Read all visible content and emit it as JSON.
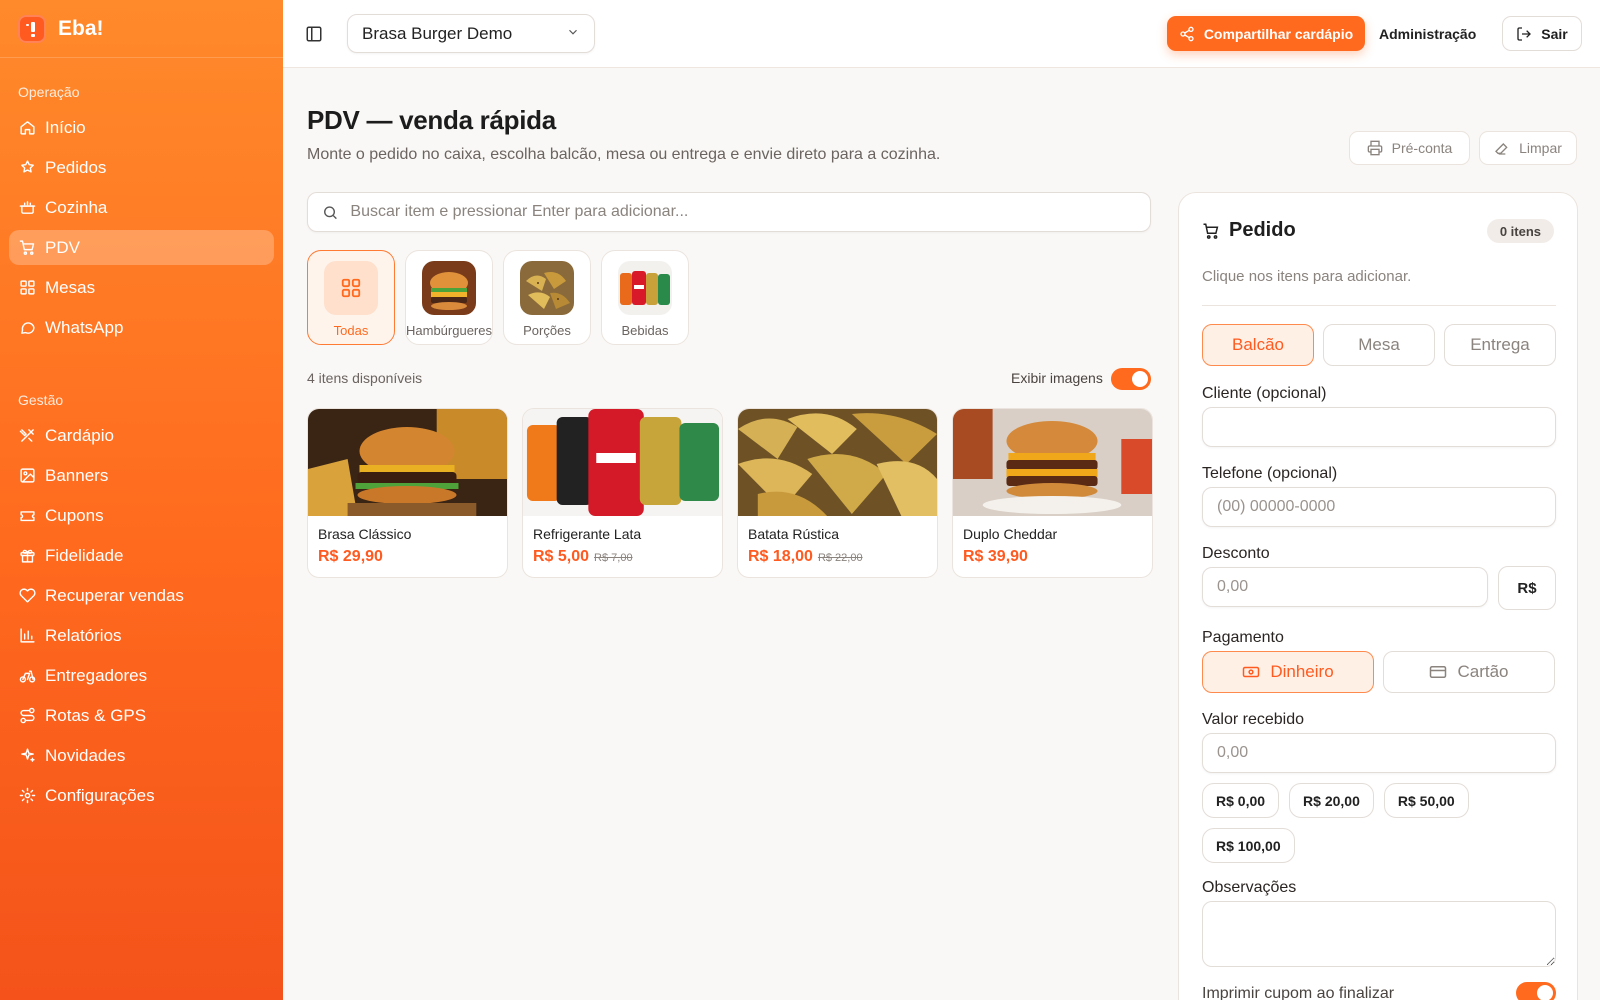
{
  "brand": {
    "name": "Eba!"
  },
  "sidebar": {
    "sections": [
      {
        "title": "Operação",
        "items": [
          {
            "label": "Início",
            "icon": "home-icon"
          },
          {
            "label": "Pedidos",
            "icon": "receipt-icon"
          },
          {
            "label": "Cozinha",
            "icon": "cooking-pot-icon"
          },
          {
            "label": "PDV",
            "icon": "cart-icon",
            "active": true
          },
          {
            "label": "Mesas",
            "icon": "grid-icon"
          },
          {
            "label": "WhatsApp",
            "icon": "chat-icon"
          }
        ]
      },
      {
        "title": "Gestão",
        "items": [
          {
            "label": "Cardápio",
            "icon": "utensils-icon"
          },
          {
            "label": "Banners",
            "icon": "image-icon"
          },
          {
            "label": "Cupons",
            "icon": "ticket-icon"
          },
          {
            "label": "Fidelidade",
            "icon": "gift-icon"
          },
          {
            "label": "Recuperar vendas",
            "icon": "heart-handshake-icon"
          },
          {
            "label": "Relatórios",
            "icon": "bar-chart-icon"
          },
          {
            "label": "Entregadores",
            "icon": "bike-icon"
          },
          {
            "label": "Rotas & GPS",
            "icon": "route-icon"
          },
          {
            "label": "Novidades",
            "icon": "sparkles-icon"
          },
          {
            "label": "Configurações",
            "icon": "settings-icon"
          }
        ]
      }
    ]
  },
  "topbar": {
    "store": "Brasa Burger Demo",
    "share_label": "Compartilhar cardápio",
    "admin_label": "Administração",
    "logout_label": "Sair"
  },
  "page": {
    "title": "PDV — venda rápida",
    "subtitle": "Monte o pedido no caixa, escolha balcão, mesa ou entrega e envie direto para a cozinha.",
    "precount_label": "Pré-conta",
    "clear_label": "Limpar",
    "search_placeholder": "Buscar item e pressionar Enter para adicionar...",
    "categories": [
      {
        "label": "Todas",
        "active": true
      },
      {
        "label": "Hambúrgueres"
      },
      {
        "label": "Porções"
      },
      {
        "label": "Bebidas"
      }
    ],
    "available_count": "4 itens disponíveis",
    "show_images_label": "Exibir imagens",
    "show_images_on": true,
    "products": [
      {
        "name": "Brasa Clássico",
        "price": "R$ 29,90",
        "old_price": ""
      },
      {
        "name": "Refrigerante Lata",
        "price": "R$ 5,00",
        "old_price": "R$ 7,00"
      },
      {
        "name": "Batata Rústica",
        "price": "R$ 18,00",
        "old_price": "R$ 22,00"
      },
      {
        "name": "Duplo Cheddar",
        "price": "R$ 39,90",
        "old_price": ""
      }
    ]
  },
  "order": {
    "title": "Pedido",
    "count": "0 itens",
    "hint": "Clique nos itens para adicionar.",
    "modes": [
      "Balcão",
      "Mesa",
      "Entrega"
    ],
    "active_mode": "Balcão",
    "customer_label": "Cliente (opcional)",
    "phone_label": "Telefone (opcional)",
    "phone_placeholder": "(00) 00000-0000",
    "discount_label": "Desconto",
    "discount_placeholder": "0,00",
    "discount_unit": "R$",
    "payment_label": "Pagamento",
    "payment_cash": "Dinheiro",
    "payment_card": "Cartão",
    "received_label": "Valor recebido",
    "received_placeholder": "0,00",
    "quick_values": [
      "R$ 0,00",
      "R$ 20,00",
      "R$ 50,00",
      "R$ 100,00"
    ],
    "notes_label": "Observações",
    "print_label": "Imprimir cupom ao finalizar",
    "print_on": true
  },
  "colors": {
    "accent": "#ff6a1e",
    "accent_soft": "#fff0e6"
  }
}
